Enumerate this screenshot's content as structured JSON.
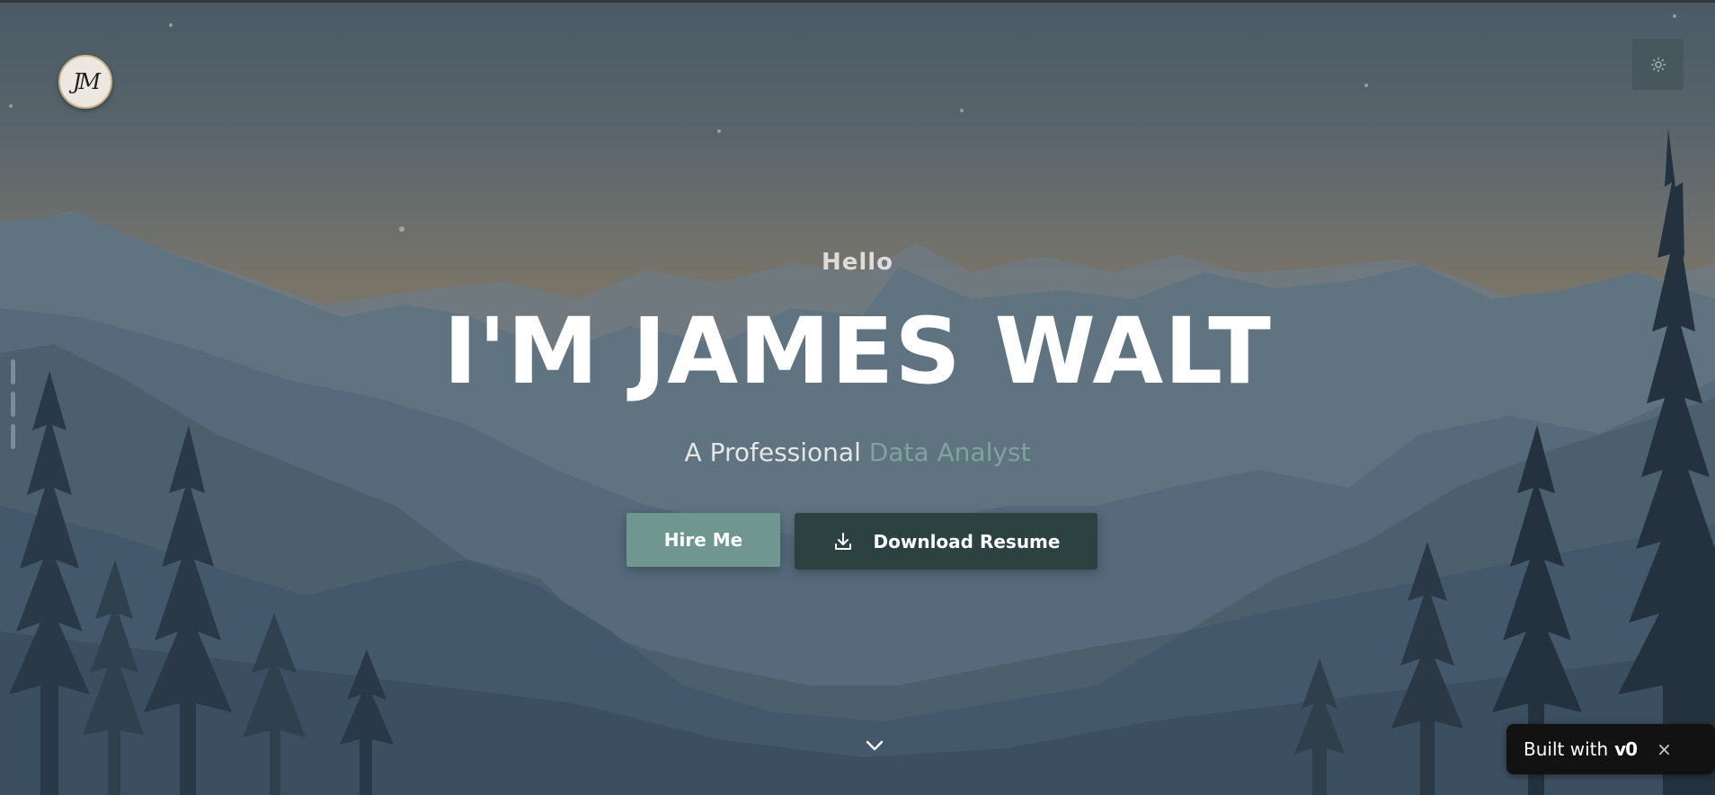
{
  "logo": {
    "monogram": "JM"
  },
  "theme_toggle": {
    "icon": "sun-icon"
  },
  "side_nav": {
    "count": 3
  },
  "hero": {
    "greeting": "Hello",
    "headline": "I'M JAMES WALT",
    "subtitle_prefix": "A Professional",
    "subtitle_accent": "Data Analyst"
  },
  "buttons": {
    "hire_label": "Hire Me",
    "resume_label": "Download Resume",
    "resume_icon": "download-icon"
  },
  "scroll_indicator": {
    "icon": "chevron-down-icon"
  },
  "badge": {
    "built_with": "Built with",
    "brand": "v0",
    "close_symbol": "×"
  },
  "colors": {
    "accent": "#7ea49b",
    "hire_button": "#6f9790",
    "resume_button": "#2b4240",
    "badge_bg": "#121212"
  }
}
